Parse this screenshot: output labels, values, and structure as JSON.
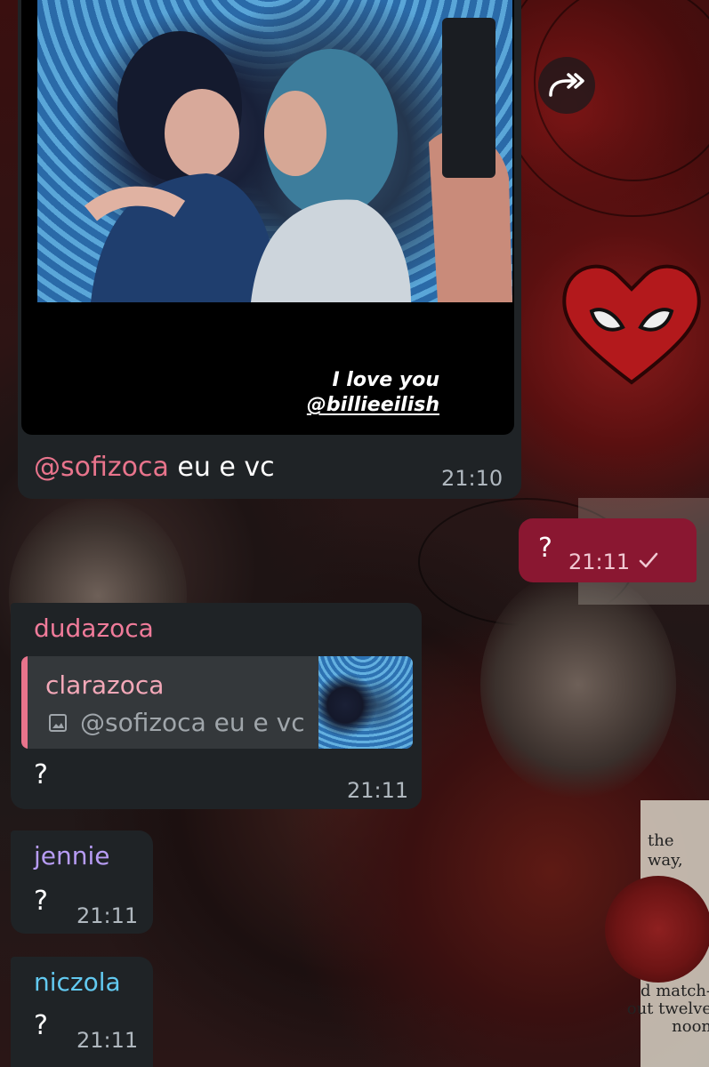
{
  "colors": {
    "incoming_bubble": "#1f2326",
    "outgoing_bubble": "#8a1731",
    "mention": "#e8748c",
    "sender_dudazoca": "#f07b9a",
    "sender_jennie": "#b79cf4",
    "sender_niczola": "#62c9f0"
  },
  "messages": {
    "media": {
      "story_caption_line1": "I love you",
      "story_caption_line2": "@billieeilish",
      "mention": "@sofizoca",
      "text": " eu e vc",
      "time": "21:10",
      "forward_icon": "forward-icon"
    },
    "outgoing": {
      "text": "?",
      "time": "21:11",
      "status_icon": "check-icon"
    },
    "dudazoca": {
      "sender": "dudazoca",
      "reply_author": "clarazoca",
      "reply_icon": "image-icon",
      "reply_text": "@sofizoca eu e vc",
      "text": "?",
      "time": "21:11"
    },
    "jennie": {
      "sender": "jennie",
      "text": "?",
      "time": "21:11"
    },
    "niczola": {
      "sender": "niczola",
      "text": "?",
      "time": "21:11"
    }
  }
}
